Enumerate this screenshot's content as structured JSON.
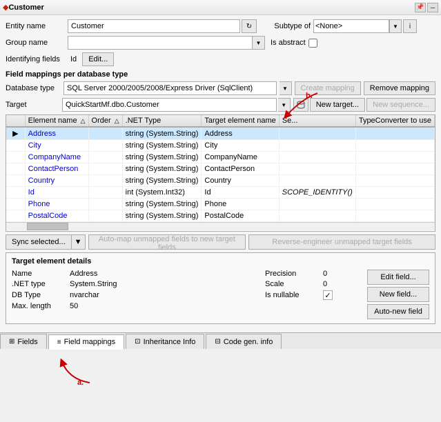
{
  "titlebar": {
    "diamond": "◆",
    "title": "Customer",
    "controls": [
      "─",
      "□",
      "✕"
    ]
  },
  "form": {
    "entity_name_label": "Entity name",
    "entity_name_value": "Customer",
    "subtype_label": "Subtype of",
    "subtype_value": "<None>",
    "group_name_label": "Group name",
    "is_abstract_label": "Is abstract",
    "identifying_label": "Identifying fields",
    "identifying_value": "Id",
    "edit_label": "Edit...",
    "section_label": "Field mappings per database type",
    "db_type_label": "Database type",
    "db_type_value": "SQL Server 2000/2005/2008/Express Driver (SqlClient)",
    "create_mapping_label": "Create mapping",
    "remove_mapping_label": "Remove mapping",
    "target_label": "Target",
    "target_value": "QuickStartMf.dbo.Customer",
    "new_target_label": "New target...",
    "new_sequence_label": "New sequence..."
  },
  "table": {
    "columns": [
      "Element name",
      "Order",
      ".NET Type",
      "Target element name",
      "Se...",
      "TypeConverter to use"
    ],
    "rows": [
      {
        "arrow": "▶",
        "name": "Address",
        "order": "",
        "net_type": "string (System.String)",
        "target": "Address",
        "se": "",
        "converter": "",
        "selected": true
      },
      {
        "arrow": "",
        "name": "City",
        "order": "",
        "net_type": "string (System.String)",
        "target": "City",
        "se": "",
        "converter": ""
      },
      {
        "arrow": "",
        "name": "CompanyName",
        "order": "",
        "net_type": "string (System.String)",
        "target": "CompanyName",
        "se": "",
        "converter": ""
      },
      {
        "arrow": "",
        "name": "ContactPerson",
        "order": "",
        "net_type": "string (System.String)",
        "target": "ContactPerson",
        "se": "",
        "converter": ""
      },
      {
        "arrow": "",
        "name": "Country",
        "order": "",
        "net_type": "string (System.String)",
        "target": "Country",
        "se": "",
        "converter": ""
      },
      {
        "arrow": "",
        "name": "Id",
        "order": "",
        "net_type": "int (System.Int32)",
        "target": "Id",
        "se": "SCOPE_IDENTITY()",
        "converter": ""
      },
      {
        "arrow": "",
        "name": "Phone",
        "order": "",
        "net_type": "string (System.String)",
        "target": "Phone",
        "se": "",
        "converter": ""
      },
      {
        "arrow": "",
        "name": "PostalCode",
        "order": "",
        "net_type": "string (System.String)",
        "target": "PostalCode",
        "se": "",
        "converter": ""
      }
    ]
  },
  "buttons": {
    "sync_selected": "Sync selected...",
    "auto_map": "Auto-map unmapped fields to new target fields",
    "reverse_engineer": "Reverse-engineer unmapped target fields"
  },
  "details": {
    "title": "Target element details",
    "name_label": "Name",
    "name_value": "Address",
    "net_type_label": ".NET type",
    "net_type_value": "System.String",
    "db_type_label": "DB Type",
    "db_type_value": "nvarchar",
    "max_length_label": "Max. length",
    "max_length_value": "50",
    "precision_label": "Precision",
    "precision_value": "0",
    "scale_label": "Scale",
    "scale_value": "0",
    "is_nullable_label": "Is nullable",
    "is_nullable_checked": true,
    "edit_field_label": "Edit field...",
    "new_field_label": "New field...",
    "auto_new_field_label": "Auto-new field"
  },
  "tabs": [
    {
      "icon": "⊞",
      "label": "Fields",
      "active": false
    },
    {
      "icon": "≡",
      "label": "Field mappings",
      "active": true
    },
    {
      "icon": "⊡",
      "label": "Inheritance Info",
      "active": false
    },
    {
      "icon": "⊟",
      "label": "Code gen. info",
      "active": false
    }
  ],
  "annotations": {
    "a": "a.",
    "b": "b."
  }
}
